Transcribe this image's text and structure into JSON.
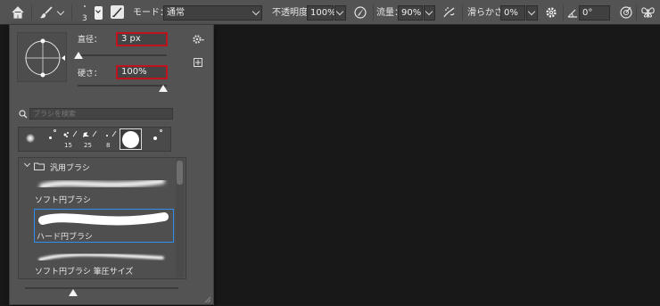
{
  "options_bar": {
    "brush_size": "3",
    "mode_label": "モード：",
    "mode_value": "通常",
    "opacity_label": "不透明度：",
    "opacity_value": "100%",
    "flow_label": "流量：",
    "flow_value": "90%",
    "smoothing_label": "滑らかさ：",
    "smoothing_value": "0%",
    "angle_value": "0°"
  },
  "brush_panel": {
    "size_label": "直径：",
    "size_value": "3 px",
    "hardness_label": "硬さ：",
    "hardness_value": "100%",
    "size_slider": 0.02,
    "hardness_slider": 1.0,
    "search_placeholder": "ブラシを検索",
    "presets": [
      {
        "size": ""
      },
      {
        "size": ""
      },
      {
        "size": "15"
      },
      {
        "size": "25"
      },
      {
        "size": "8"
      },
      {
        "size": ""
      },
      {
        "size": ""
      }
    ],
    "group_name": "汎用ブラシ",
    "brushes": [
      {
        "name": "ソフト円ブラシ",
        "selected": false
      },
      {
        "name": "ハード円ブラシ",
        "selected": true
      },
      {
        "name": "ソフト円ブラシ 筆圧サイズ",
        "selected": false
      }
    ],
    "preview_zoom": 0.25
  },
  "colors": {
    "highlight_border": "#c1121f",
    "selection_border": "#2f8ff0"
  }
}
